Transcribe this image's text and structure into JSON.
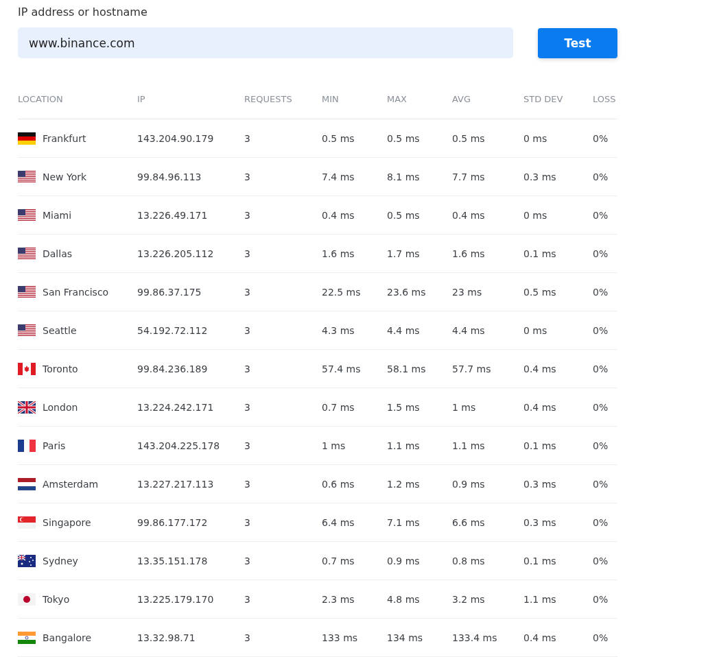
{
  "form": {
    "label": "IP address or hostname",
    "value": "www.binance.com",
    "button": "Test"
  },
  "table": {
    "columns": [
      "LOCATION",
      "IP",
      "REQUESTS",
      "MIN",
      "MAX",
      "AVG",
      "STD DEV",
      "LOSS"
    ],
    "rows": [
      {
        "kind": "de",
        "cells": [
          "Frankfurt",
          "143.204.90.179",
          "3",
          "0.5 ms",
          "0.5 ms",
          "0.5 ms",
          "0 ms",
          "0%"
        ]
      },
      {
        "kind": "us",
        "cells": [
          "New York",
          "99.84.96.113",
          "3",
          "7.4 ms",
          "8.1 ms",
          "7.7 ms",
          "0.3 ms",
          "0%"
        ]
      },
      {
        "kind": "us",
        "cells": [
          "Miami",
          "13.226.49.171",
          "3",
          "0.4 ms",
          "0.5 ms",
          "0.4 ms",
          "0 ms",
          "0%"
        ]
      },
      {
        "kind": "us",
        "cells": [
          "Dallas",
          "13.226.205.112",
          "3",
          "1.6 ms",
          "1.7 ms",
          "1.6 ms",
          "0.1 ms",
          "0%"
        ]
      },
      {
        "kind": "us",
        "cells": [
          "San Francisco",
          "99.86.37.175",
          "3",
          "22.5 ms",
          "23.6 ms",
          "23 ms",
          "0.5 ms",
          "0%"
        ]
      },
      {
        "kind": "us",
        "cells": [
          "Seattle",
          "54.192.72.112",
          "3",
          "4.3 ms",
          "4.4 ms",
          "4.4 ms",
          "0 ms",
          "0%"
        ]
      },
      {
        "kind": "ca",
        "cells": [
          "Toronto",
          "99.84.236.189",
          "3",
          "57.4 ms",
          "58.1 ms",
          "57.7 ms",
          "0.4 ms",
          "0%"
        ]
      },
      {
        "kind": "gb",
        "cells": [
          "London",
          "13.224.242.171",
          "3",
          "0.7 ms",
          "1.5 ms",
          "1 ms",
          "0.4 ms",
          "0%"
        ]
      },
      {
        "kind": "fr",
        "cells": [
          "Paris",
          "143.204.225.178",
          "3",
          "1 ms",
          "1.1 ms",
          "1.1 ms",
          "0.1 ms",
          "0%"
        ]
      },
      {
        "kind": "nl",
        "cells": [
          "Amsterdam",
          "13.227.217.113",
          "3",
          "0.6 ms",
          "1.2 ms",
          "0.9 ms",
          "0.3 ms",
          "0%"
        ]
      },
      {
        "kind": "sg",
        "cells": [
          "Singapore",
          "99.86.177.172",
          "3",
          "6.4 ms",
          "7.1 ms",
          "6.6 ms",
          "0.3 ms",
          "0%"
        ]
      },
      {
        "kind": "au",
        "cells": [
          "Sydney",
          "13.35.151.178",
          "3",
          "0.7 ms",
          "0.9 ms",
          "0.8 ms",
          "0.1 ms",
          "0%"
        ]
      },
      {
        "kind": "jp",
        "cells": [
          "Tokyo",
          "13.225.179.170",
          "3",
          "2.3 ms",
          "4.8 ms",
          "3.2 ms",
          "1.1 ms",
          "0%"
        ]
      },
      {
        "kind": "in",
        "cells": [
          "Bangalore",
          "13.32.98.71",
          "3",
          "133 ms",
          "134 ms",
          "133.4 ms",
          "0.4 ms",
          "0%"
        ]
      }
    ]
  }
}
